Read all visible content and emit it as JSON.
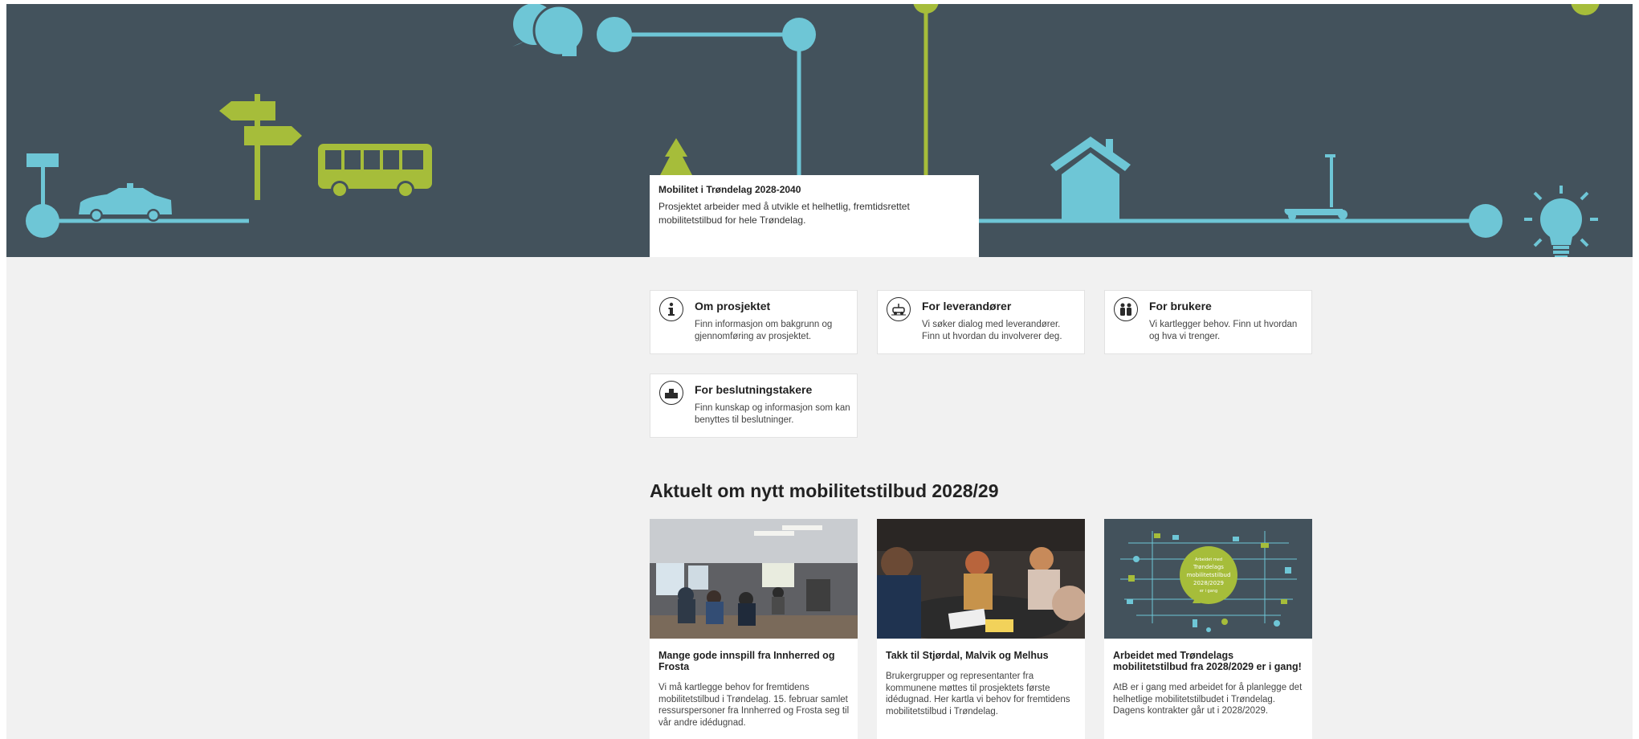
{
  "hero": {
    "title": "Mobilitet i Trøndelag 2028-2040",
    "description": "Prosjektet arbeider med å utvikle et helhetlig, fremtidsrettet mobilitetstilbud for hele Trøndelag."
  },
  "colors": {
    "hero_bg": "#43525c",
    "accent_blue": "#6ec6d6",
    "accent_green": "#a6bd3a",
    "page_bg": "#f1f1f1"
  },
  "tiles": [
    {
      "icon": "info-icon",
      "title": "Om prosjektet",
      "text": "Finn informasjon om bakgrunn og gjennomføring av prosjektet."
    },
    {
      "icon": "vehicle-icon",
      "title": "For leverandører",
      "text": "Vi søker dialog med leverandører. Finn ut hvordan du involverer deg."
    },
    {
      "icon": "people-icon",
      "title": "For brukere",
      "text": "Vi kartlegger behov. Finn ut hvordan og hva vi trenger."
    },
    {
      "icon": "podium-icon",
      "title": "For beslutningstakere",
      "text": "Finn kunskap og informasjon som kan benyttes til beslutninger."
    }
  ],
  "news_section": {
    "title": "Aktuelt om nytt mobilitetstilbud 2028/29",
    "items": [
      {
        "title": "Mange gode innspill fra Innherred og Frosta",
        "text": "Vi må kartlegge behov for fremtidens mobilitetstilbud i Trøndelag. 15. februar samlet ressurspersoner fra Innherred og Frosta seg til vår andre idédugnad."
      },
      {
        "title": "Takk til Stjørdal, Malvik og Melhus",
        "text": "Brukergrupper og representanter fra kommunene møttes til prosjektets første idédugnad. Her kartla vi behov for fremtidens mobilitetstilbud i Trøndelag."
      },
      {
        "title": "Arbeidet med Trøndelags mobilitetstilbud fra 2028/2029 er i gang!",
        "text": "AtB er i gang med arbeidet for å planlegge det helhetlige mobilitetstilbudet i Trøndelag. Dagens kontrakter går ut i 2028/2029."
      }
    ],
    "infographic_text": [
      "Arbeidet med",
      "Trøndelags",
      "mobilitetstilbud",
      "2028/2029",
      "er i gang"
    ]
  }
}
